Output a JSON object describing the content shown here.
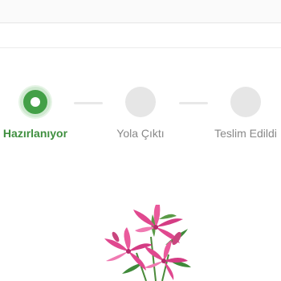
{
  "stepper": {
    "steps": [
      {
        "label": "Hazırlanıyor",
        "status": "active"
      },
      {
        "label": "Yola Çıktı",
        "status": "pending"
      },
      {
        "label": "Teslim Edildi",
        "status": "pending"
      }
    ]
  },
  "product": {
    "image_icon": "lily-flower-bouquet-icon"
  },
  "colors": {
    "accent": "#43a047",
    "active_label": "#3f8f3f",
    "pending_circle": "#e6e6e6",
    "pending_label": "#888888",
    "petal_pink": "#e0488f"
  }
}
